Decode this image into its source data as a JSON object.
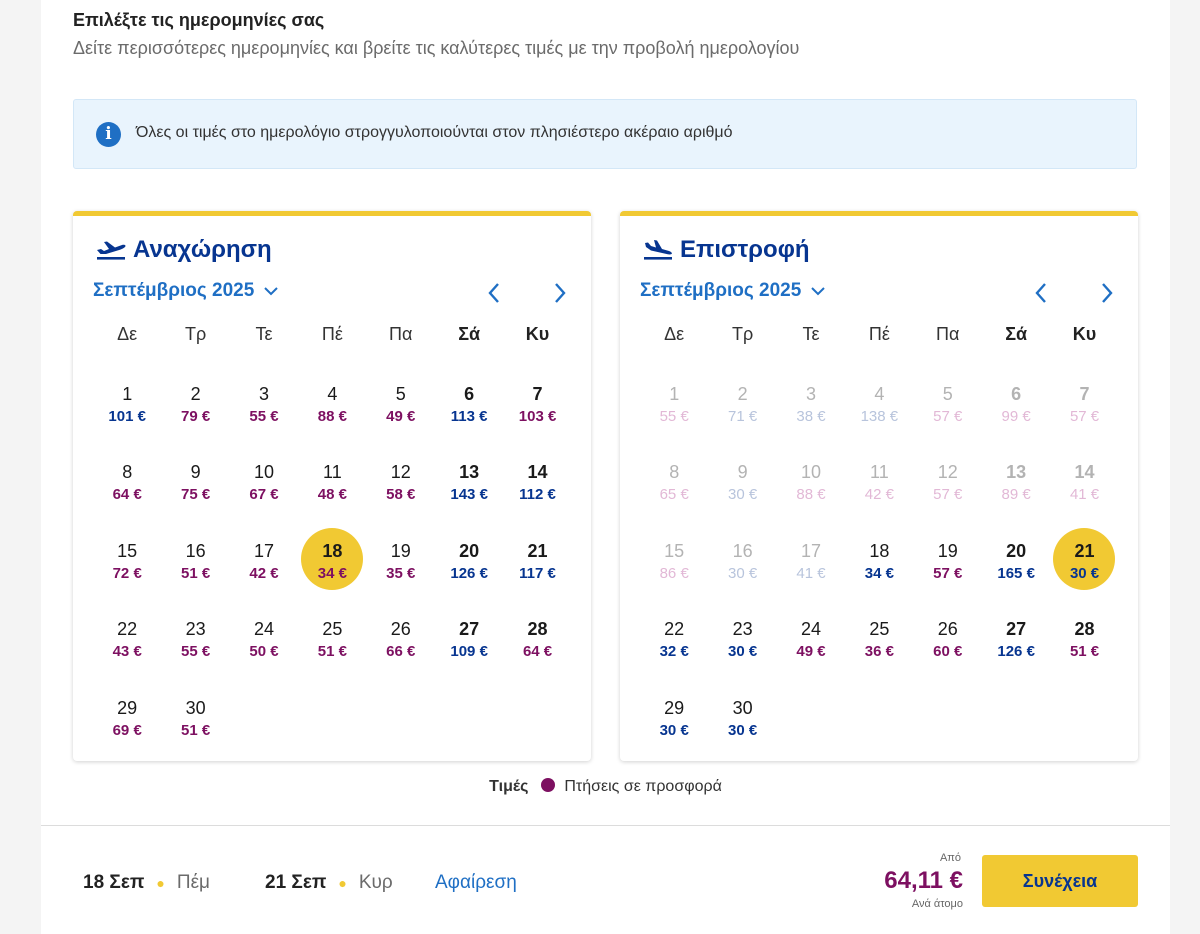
{
  "header": {
    "title": "Επιλέξτε τις ημερομηνίες σας",
    "subtitle": "Δείτε περισσότερες ημερομηνίες και βρείτε τις καλύτερες τιμές με την προβολή ημερολογίου"
  },
  "info": {
    "text": "Όλες οι τιμές στο ημερολόγιο στρογγυλοποιούνται στον πλησιέστερο ακέραιο αριθμό"
  },
  "weekdays": [
    "Δε",
    "Τρ",
    "Τε",
    "Πέ",
    "Πα",
    "Σά",
    "Κυ"
  ],
  "colors": {
    "accent_yellow": "#f1c933",
    "brand_blue": "#073590",
    "link_blue": "#1f6fc4",
    "offer_purple": "#7d1061"
  },
  "calendars": {
    "departure": {
      "title": "Αναχώρηση",
      "icon": "plane-departure-icon",
      "month": "Σεπτέμβριος 2025",
      "selected_day": 18,
      "days": [
        {
          "d": "1",
          "p": "101 €",
          "offer": false,
          "disabled": false
        },
        {
          "d": "2",
          "p": "79 €",
          "offer": true,
          "disabled": false
        },
        {
          "d": "3",
          "p": "55 €",
          "offer": true,
          "disabled": false
        },
        {
          "d": "4",
          "p": "88 €",
          "offer": true,
          "disabled": false
        },
        {
          "d": "5",
          "p": "49 €",
          "offer": true,
          "disabled": false
        },
        {
          "d": "6",
          "p": "113 €",
          "offer": false,
          "disabled": false
        },
        {
          "d": "7",
          "p": "103 €",
          "offer": true,
          "disabled": false
        },
        {
          "d": "8",
          "p": "64 €",
          "offer": true,
          "disabled": false
        },
        {
          "d": "9",
          "p": "75 €",
          "offer": true,
          "disabled": false
        },
        {
          "d": "10",
          "p": "67 €",
          "offer": true,
          "disabled": false
        },
        {
          "d": "11",
          "p": "48 €",
          "offer": true,
          "disabled": false
        },
        {
          "d": "12",
          "p": "58 €",
          "offer": true,
          "disabled": false
        },
        {
          "d": "13",
          "p": "143 €",
          "offer": false,
          "disabled": false
        },
        {
          "d": "14",
          "p": "112 €",
          "offer": false,
          "disabled": false
        },
        {
          "d": "15",
          "p": "72 €",
          "offer": true,
          "disabled": false
        },
        {
          "d": "16",
          "p": "51 €",
          "offer": true,
          "disabled": false
        },
        {
          "d": "17",
          "p": "42 €",
          "offer": true,
          "disabled": false
        },
        {
          "d": "18",
          "p": "34 €",
          "offer": true,
          "disabled": false
        },
        {
          "d": "19",
          "p": "35 €",
          "offer": true,
          "disabled": false
        },
        {
          "d": "20",
          "p": "126 €",
          "offer": false,
          "disabled": false
        },
        {
          "d": "21",
          "p": "117 €",
          "offer": false,
          "disabled": false
        },
        {
          "d": "22",
          "p": "43 €",
          "offer": true,
          "disabled": false
        },
        {
          "d": "23",
          "p": "55 €",
          "offer": true,
          "disabled": false
        },
        {
          "d": "24",
          "p": "50 €",
          "offer": true,
          "disabled": false
        },
        {
          "d": "25",
          "p": "51 €",
          "offer": true,
          "disabled": false
        },
        {
          "d": "26",
          "p": "66 €",
          "offer": true,
          "disabled": false
        },
        {
          "d": "27",
          "p": "109 €",
          "offer": false,
          "disabled": false
        },
        {
          "d": "28",
          "p": "64 €",
          "offer": true,
          "disabled": false
        },
        {
          "d": "29",
          "p": "69 €",
          "offer": true,
          "disabled": false
        },
        {
          "d": "30",
          "p": "51 €",
          "offer": true,
          "disabled": false
        }
      ]
    },
    "return": {
      "title": "Επιστροφή",
      "icon": "plane-arrival-icon",
      "month": "Σεπτέμβριος 2025",
      "selected_day": 21,
      "days": [
        {
          "d": "1",
          "p": "55 €",
          "offer": true,
          "disabled": true
        },
        {
          "d": "2",
          "p": "71 €",
          "offer": false,
          "disabled": true
        },
        {
          "d": "3",
          "p": "38 €",
          "offer": false,
          "disabled": true
        },
        {
          "d": "4",
          "p": "138 €",
          "offer": false,
          "disabled": true
        },
        {
          "d": "5",
          "p": "57 €",
          "offer": true,
          "disabled": true
        },
        {
          "d": "6",
          "p": "99 €",
          "offer": true,
          "disabled": true
        },
        {
          "d": "7",
          "p": "57 €",
          "offer": true,
          "disabled": true
        },
        {
          "d": "8",
          "p": "65 €",
          "offer": true,
          "disabled": true
        },
        {
          "d": "9",
          "p": "30 €",
          "offer": false,
          "disabled": true
        },
        {
          "d": "10",
          "p": "88 €",
          "offer": true,
          "disabled": true
        },
        {
          "d": "11",
          "p": "42 €",
          "offer": true,
          "disabled": true
        },
        {
          "d": "12",
          "p": "57 €",
          "offer": true,
          "disabled": true
        },
        {
          "d": "13",
          "p": "89 €",
          "offer": true,
          "disabled": true
        },
        {
          "d": "14",
          "p": "41 €",
          "offer": true,
          "disabled": true
        },
        {
          "d": "15",
          "p": "86 €",
          "offer": true,
          "disabled": true
        },
        {
          "d": "16",
          "p": "30 €",
          "offer": false,
          "disabled": true
        },
        {
          "d": "17",
          "p": "41 €",
          "offer": false,
          "disabled": true
        },
        {
          "d": "18",
          "p": "34 €",
          "offer": false,
          "disabled": false
        },
        {
          "d": "19",
          "p": "57 €",
          "offer": true,
          "disabled": false
        },
        {
          "d": "20",
          "p": "165 €",
          "offer": false,
          "disabled": false
        },
        {
          "d": "21",
          "p": "30 €",
          "offer": false,
          "disabled": false
        },
        {
          "d": "22",
          "p": "32 €",
          "offer": false,
          "disabled": false
        },
        {
          "d": "23",
          "p": "30 €",
          "offer": false,
          "disabled": false
        },
        {
          "d": "24",
          "p": "49 €",
          "offer": true,
          "disabled": false
        },
        {
          "d": "25",
          "p": "36 €",
          "offer": true,
          "disabled": false
        },
        {
          "d": "26",
          "p": "60 €",
          "offer": true,
          "disabled": false
        },
        {
          "d": "27",
          "p": "126 €",
          "offer": false,
          "disabled": false
        },
        {
          "d": "28",
          "p": "51 €",
          "offer": true,
          "disabled": false
        },
        {
          "d": "29",
          "p": "30 €",
          "offer": false,
          "disabled": false
        },
        {
          "d": "30",
          "p": "30 €",
          "offer": false,
          "disabled": false
        }
      ]
    }
  },
  "legend": {
    "label": "Τιμές",
    "offers": "Πτήσεις σε προσφορά"
  },
  "footer": {
    "outbound_date": "18 Σεπ",
    "outbound_weekday": "Πέμ",
    "return_date": "21 Σεπ",
    "return_weekday": "Κυρ",
    "remove_label": "Αφαίρεση",
    "from_label": "Από",
    "total_price": "64,11 €",
    "per_person": "Ανά άτομο",
    "continue_label": "Συνέχεια"
  }
}
